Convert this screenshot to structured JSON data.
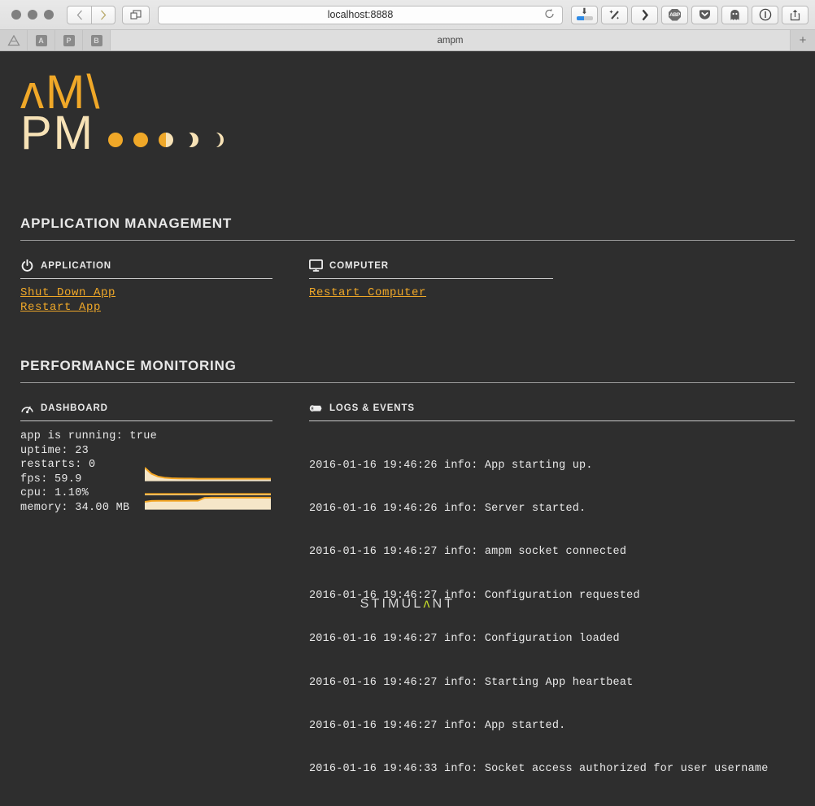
{
  "browser": {
    "url": "localhost:8888",
    "tab_title": "ampm",
    "reload_icon": "reload-icon",
    "back_icon": "chevron-left-icon",
    "forward_icon": "chevron-right-icon",
    "tabs_overview_icon": "tabs-overview-icon",
    "new_tab_label": "+",
    "bookmarks": [
      {
        "label": "",
        "icon": "google-drive-icon"
      },
      {
        "label": "A",
        "icon": "bookmark-a-icon"
      },
      {
        "label": "P",
        "icon": "bookmark-p-icon"
      },
      {
        "label": "B",
        "icon": "bookmark-b-icon"
      }
    ],
    "extensions": [
      {
        "name": "downloads-button",
        "icon": "download-progress-icon",
        "label": ""
      },
      {
        "name": "magic-wand-button",
        "icon": "magic-wand-icon",
        "label": "✦"
      },
      {
        "name": "chevron-button",
        "icon": "chevron-right-icon",
        "label": "❯"
      },
      {
        "name": "adblock-plus-button",
        "icon": "abp-icon",
        "label": "ABP"
      },
      {
        "name": "pocket-button",
        "icon": "pocket-icon",
        "label": "▼"
      },
      {
        "name": "ghostery-button",
        "icon": "ghost-icon",
        "label": "●"
      },
      {
        "name": "onepassword-button",
        "icon": "circled-one-icon",
        "label": "⓪"
      },
      {
        "name": "share-button",
        "icon": "share-icon",
        "label": "⇧"
      }
    ]
  },
  "logo": {
    "line1": "ʌM\\",
    "line2": "PM",
    "moon_phases": [
      "full",
      "full",
      "half",
      "crescent",
      "crescent-thin"
    ],
    "color_primary": "#f0a828",
    "color_secondary": "#f7e2b6"
  },
  "sections": {
    "app_management": {
      "title": "APPLICATION MANAGEMENT",
      "application": {
        "label": "APPLICATION",
        "icon": "power-icon",
        "links": [
          "Shut Down App",
          "Restart App"
        ]
      },
      "computer": {
        "label": "COMPUTER",
        "icon": "monitor-icon",
        "links": [
          "Restart Computer"
        ]
      }
    },
    "performance": {
      "title": "PERFORMANCE MONITORING",
      "dashboard": {
        "label": "DASHBOARD",
        "icon": "gauge-icon",
        "stats": [
          "app is running: true",
          "uptime: 23",
          "restarts: 0",
          "fps: 59.9",
          "cpu: 1.10%",
          "memory: 34.00 MB"
        ]
      },
      "logs": {
        "label": "LOGS & EVENTS",
        "icon": "scroll-icon",
        "entries": [
          "2016-01-16 19:46:26 info: App starting up.",
          "2016-01-16 19:46:26 info: Server started.",
          "2016-01-16 19:46:27 info: ampm socket connected",
          "2016-01-16 19:46:27 info: Configuration requested",
          "2016-01-16 19:46:27 info: Configuration loaded",
          "2016-01-16 19:46:27 info: Starting App heartbeat",
          "2016-01-16 19:46:27 info: App started.",
          "2016-01-16 19:46:33 info: Socket access authorized for user username"
        ]
      }
    }
  },
  "footer": {
    "brand_pre": "STIMUL",
    "brand_lambda": "ʌ",
    "brand_post": "NT",
    "lambda_color": "#c2d92a"
  },
  "chart_data": [
    {
      "type": "area",
      "name": "fps-sparkline",
      "title": "fps",
      "x": [
        0,
        1,
        2,
        3,
        4,
        5,
        6,
        7,
        8,
        9,
        10,
        11,
        12,
        13,
        14,
        15,
        16,
        17,
        18,
        19
      ],
      "values": [
        100,
        52,
        30,
        21,
        17,
        15,
        14,
        14,
        13,
        13,
        13,
        13,
        13,
        13,
        13,
        13,
        13,
        13,
        13,
        13
      ],
      "ylim": [
        0,
        100
      ],
      "stroke": "#f5a623",
      "fill": "#f5e6c8"
    },
    {
      "type": "area",
      "name": "cpu-sparkline",
      "title": "cpu",
      "x": [
        0,
        1,
        2,
        3,
        4,
        5,
        6,
        7,
        8,
        9,
        10,
        11,
        12,
        13,
        14,
        15,
        16,
        17,
        18,
        19
      ],
      "values": [
        8,
        8,
        8,
        8,
        8,
        8,
        8,
        8,
        8,
        8,
        8,
        8,
        8,
        8,
        8,
        8,
        8,
        8,
        8,
        8
      ],
      "ylim": [
        0,
        100
      ],
      "stroke": "#f5a623",
      "fill": "#f5e6c8"
    },
    {
      "type": "area",
      "name": "memory-sparkline",
      "title": "memory",
      "x": [
        0,
        1,
        2,
        3,
        4,
        5,
        6,
        7,
        8,
        9,
        10,
        11,
        12,
        13,
        14,
        15,
        16,
        17,
        18,
        19
      ],
      "values": [
        55,
        62,
        63,
        63,
        63,
        63,
        63,
        64,
        64,
        86,
        88,
        88,
        88,
        88,
        88,
        88,
        88,
        88,
        88,
        88
      ],
      "ylim": [
        0,
        100
      ],
      "stroke": "#f5a623",
      "fill": "#f5e6c8"
    }
  ]
}
